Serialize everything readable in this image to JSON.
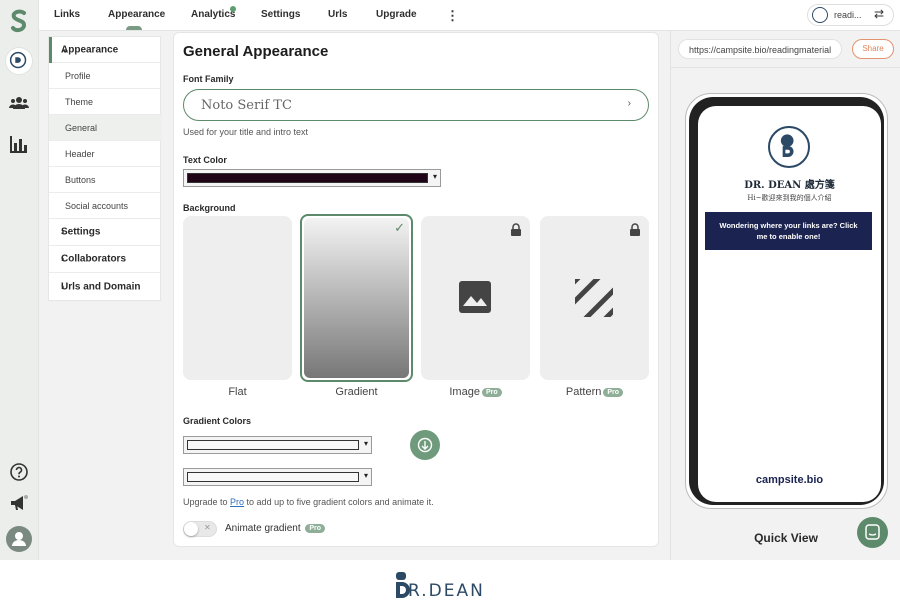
{
  "topnav": {
    "tabs": [
      "Links",
      "Appearance",
      "Analytics",
      "Settings",
      "Urls",
      "Upgrade"
    ],
    "more_label": "⋮",
    "account_name": "readi...",
    "switch_icon": "⇄"
  },
  "rail": {
    "icons": [
      "campsite-logo-icon",
      "profile-avatar-icon",
      "audience-icon",
      "analytics-icon",
      "help-icon",
      "announcements-icon",
      "user-icon"
    ]
  },
  "subnav": {
    "appearance": "Appearance",
    "items": [
      "Profile",
      "Theme",
      "General",
      "Header",
      "Buttons",
      "Social accounts"
    ],
    "settings": "Settings",
    "collaborators": "Collaborators",
    "urls": "Urls and Domain",
    "chevron_down": "⌄",
    "chevron_right": "›"
  },
  "main": {
    "title": "General Appearance",
    "font_family_label": "Font Family",
    "font_family_value": "Noto Serif TC",
    "font_family_help": "Used for your title and intro text",
    "text_color_label": "Text Color",
    "text_color": "#1e0416",
    "background_label": "Background",
    "backgrounds": [
      {
        "label": "Flat",
        "pro": ""
      },
      {
        "label": "Gradient",
        "pro": ""
      },
      {
        "label": "Image",
        "pro": "Pro"
      },
      {
        "label": "Pattern",
        "pro": "Pro"
      }
    ],
    "selected_background": "Gradient",
    "gradient_colors_label": "Gradient Colors",
    "upgrade_pre": "Upgrade to ",
    "upgrade_link": "Pro",
    "upgrade_post": " to add up to five gradient colors and animate it.",
    "animate_label": "Animate gradient",
    "animate_pro": "Pro",
    "animate_enabled": false,
    "checkmark": "✓",
    "select_arrow": "▾"
  },
  "preview": {
    "url": "https://campsite.bio/readingmaterial",
    "share_label": "Share",
    "profile_name": "DR. DEAN 處方箋",
    "profile_bio": "Hi~歡迎來到我的個人介紹",
    "cta_text": "Wondering where your links are? Click me to enable one!",
    "brand": "campsite.bio",
    "quick_view_label": "Quick View"
  },
  "footer": {
    "logo_text": "R.DEAN"
  },
  "colors": {
    "accent": "#5d8a6b",
    "cta_bg": "#1b2350",
    "share": "#e0845e"
  }
}
